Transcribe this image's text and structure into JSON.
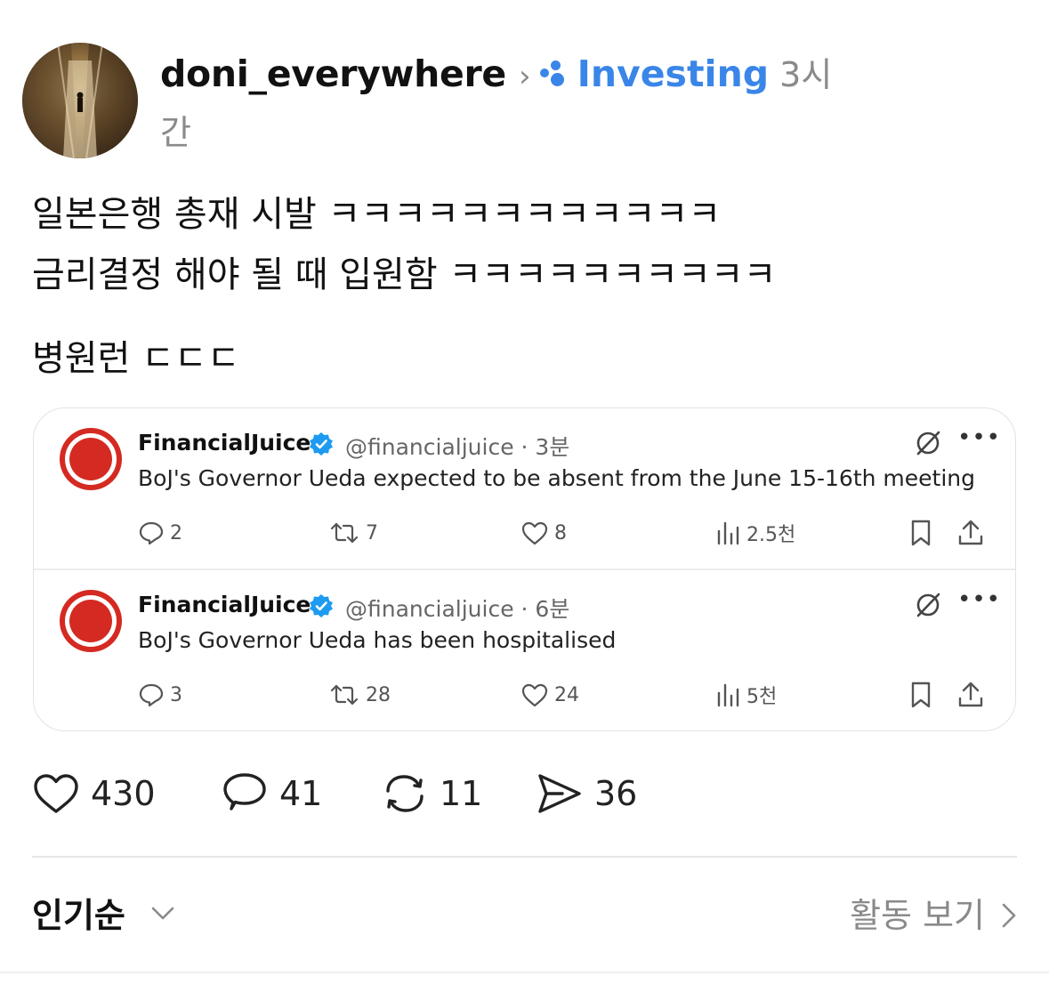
{
  "post": {
    "username": "doni_everywhere",
    "topic": "Investing",
    "time_part1": "3시",
    "time_part2": "간",
    "text_line1": "일본은행 총재 시발 ㅋㅋㅋㅋㅋㅋㅋㅋㅋㅋㅋㅋ",
    "text_line2": "금리결정 해야 될 때 입원함 ㅋㅋㅋㅋㅋㅋㅋㅋㅋㅋ",
    "text_line3": "병원런 ㄷㄷㄷ"
  },
  "embedded": {
    "tweets": [
      {
        "name": "FinancialJuice",
        "handle": "@financialjuice · 3분",
        "text": "BoJ's Governor Ueda expected to be absent from the June 15-16th meeting",
        "replies": "2",
        "reposts": "7",
        "likes": "8",
        "views": "2.5천"
      },
      {
        "name": "FinancialJuice",
        "handle": "@financialjuice · 6분",
        "text": "BoJ's Governor Ueda has been hospitalised",
        "replies": "3",
        "reposts": "28",
        "likes": "24",
        "views": "5천"
      }
    ]
  },
  "stats": {
    "likes": "430",
    "comments": "41",
    "reposts": "11",
    "shares": "36"
  },
  "footer": {
    "sort_label": "인기순",
    "activity_label": "활동 보기"
  },
  "colors": {
    "accent": "#3a86e8",
    "muted": "#8a8a8a",
    "fj_red": "#d42a22"
  },
  "icons": [
    "avatar-image",
    "chevron-right-icon",
    "topic-dots-icon",
    "verified-badge-icon",
    "grok-icon",
    "more-icon",
    "reply-icon",
    "repost-icon",
    "heart-icon",
    "views-icon",
    "bookmark-icon",
    "share-icon",
    "comment-icon",
    "send-icon",
    "chevron-down-icon"
  ]
}
